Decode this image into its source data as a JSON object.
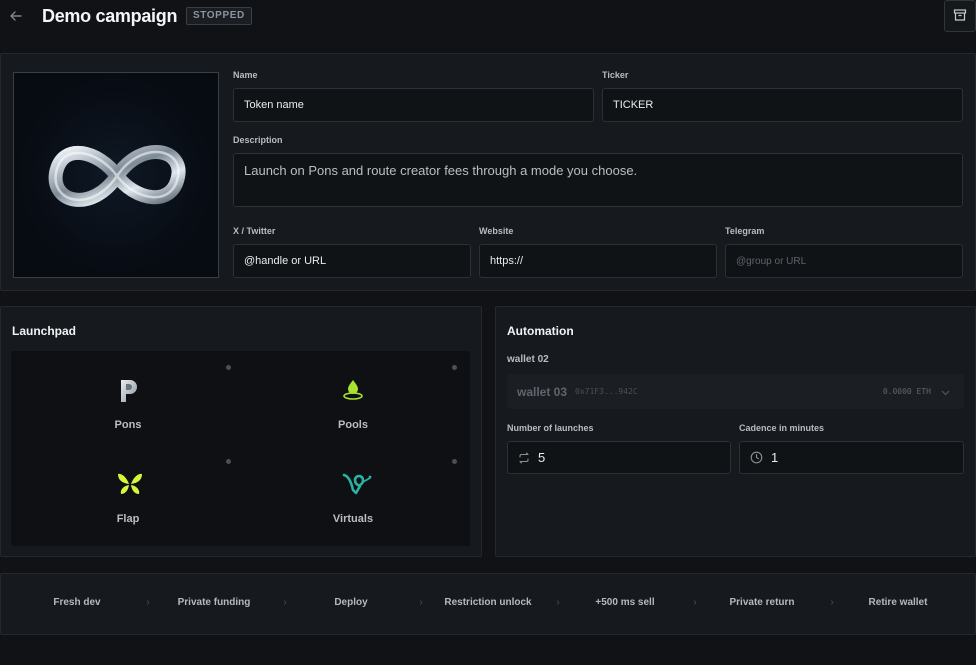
{
  "header": {
    "title": "Demo campaign",
    "status": "STOPPED"
  },
  "token": {
    "name_label": "Name",
    "name_value": "Token name",
    "ticker_label": "Ticker",
    "ticker_value": "TICKER",
    "description_label": "Description",
    "description_value": "Launch on Pons and route creator fees through a mode you choose.",
    "twitter_label": "X / Twitter",
    "twitter_value": "@handle or URL",
    "website_label": "Website",
    "website_value": "https://",
    "telegram_label": "Telegram",
    "telegram_placeholder": "@group or URL"
  },
  "launchpad": {
    "title": "Launchpad",
    "items": [
      {
        "label": "Pons",
        "icon": "pons-icon"
      },
      {
        "label": "Pools",
        "icon": "pools-icon"
      },
      {
        "label": "Flap",
        "icon": "flap-icon"
      },
      {
        "label": "Virtuals",
        "icon": "virtuals-icon"
      }
    ]
  },
  "automation": {
    "title": "Automation",
    "wallet_label": "wallet 02",
    "wallet_name": "wallet 03",
    "wallet_address": "0x71F3...942C",
    "wallet_balance": "0.0000 ETH",
    "launches_label": "Number of launches",
    "launches_value": "5",
    "cadence_label": "Cadence in minutes",
    "cadence_value": "1"
  },
  "steps": [
    "Fresh dev",
    "Private funding",
    "Deploy",
    "Restriction unlock",
    "+500 ms sell",
    "Private return",
    "Retire wallet"
  ],
  "colors": {
    "background": "#101215",
    "panel": "#16191d",
    "accent_green": "#a6e22e",
    "accent_teal": "#2ab3a2"
  }
}
